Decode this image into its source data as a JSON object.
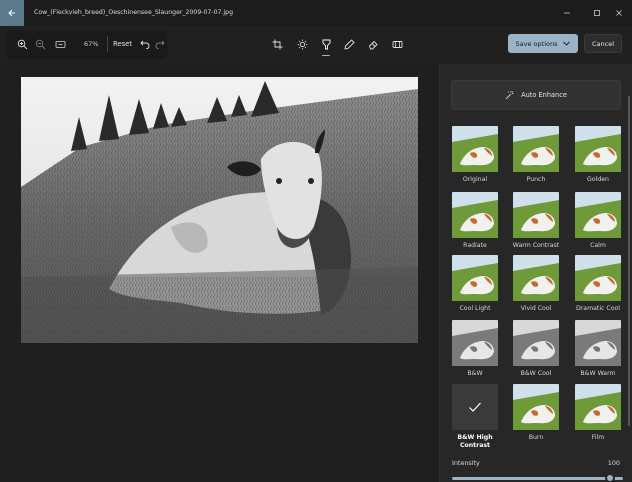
{
  "window": {
    "title": "Cow_(Fleckvieh_breed)_Oeschinensee_Slaunger_2009-07-07.jpg"
  },
  "zoom": {
    "percent": "67%",
    "reset_label": "Reset"
  },
  "actions": {
    "save_label": "Save options",
    "cancel_label": "Cancel"
  },
  "panel": {
    "auto_enhance_label": "Auto Enhance",
    "filters": [
      {
        "label": "Original",
        "style": "color"
      },
      {
        "label": "Punch",
        "style": "color"
      },
      {
        "label": "Golden",
        "style": "color"
      },
      {
        "label": "Radiate",
        "style": "color"
      },
      {
        "label": "Warm Contrast",
        "style": "color"
      },
      {
        "label": "Calm",
        "style": "color"
      },
      {
        "label": "Cool Light",
        "style": "color"
      },
      {
        "label": "Vivid Cool",
        "style": "color"
      },
      {
        "label": "Dramatic Cool",
        "style": "color"
      },
      {
        "label": "B&W",
        "style": "bw"
      },
      {
        "label": "B&W Cool",
        "style": "bw"
      },
      {
        "label": "B&W Warm",
        "style": "bw"
      },
      {
        "label": "B&W High Contrast",
        "style": "selected"
      },
      {
        "label": "Burn",
        "style": "color"
      },
      {
        "label": "Film",
        "style": "color"
      }
    ],
    "intensity_label": "Intensity",
    "intensity_value": "100"
  },
  "colors": {
    "accent": "#9ab3c6",
    "back_button": "#5a7a8c",
    "background": "#202020",
    "panel": "#272727"
  },
  "icons": {
    "back": "arrow-left-icon",
    "zoom_in": "zoom-in-icon",
    "zoom_out": "zoom-out-icon",
    "fit": "fit-screen-icon",
    "undo": "undo-icon",
    "redo": "redo-icon",
    "crop": "crop-icon",
    "adjust": "brightness-icon",
    "filter": "filter-icon",
    "markup": "pen-icon",
    "erase": "erase-icon",
    "background": "background-icon",
    "auto_enhance": "magic-wand-icon",
    "selected": "checkmark-icon"
  }
}
